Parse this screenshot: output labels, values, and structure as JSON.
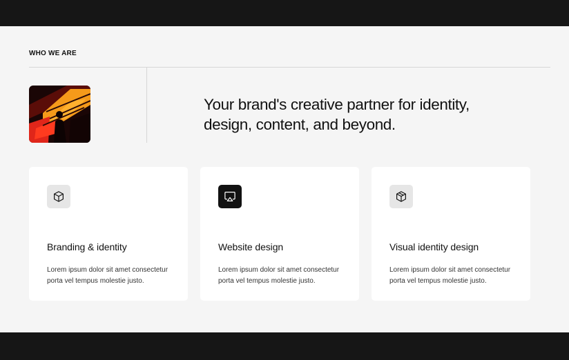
{
  "section": {
    "eyebrow": "WHO WE ARE",
    "headline": "Your brand's creative partner for identity, design, content, and beyond.",
    "image": {
      "subject": "figure-in-orange-stairwell-photo"
    }
  },
  "services": [
    {
      "icon": "cube-icon",
      "title": "Branding & identity",
      "description": "Lorem ipsum dolor sit amet consectetur porta vel tempus molestie justo."
    },
    {
      "icon": "airplay-icon",
      "title": "Website design",
      "description": "Lorem ipsum dolor sit amet consectetur porta vel tempus molestie justo."
    },
    {
      "icon": "package-icon",
      "title": "Visual identity design",
      "description": "Lorem ipsum dolor sit amet consectetur porta vel tempus molestie justo."
    }
  ],
  "colors": {
    "page_background": "#f5f5f5",
    "bar_background": "#161616",
    "card_background": "#ffffff",
    "icon_tile_light": "#e6e6e6",
    "icon_tile_dark": "#121212",
    "accent_orange": "#f59a1a",
    "accent_red": "#e0261a"
  }
}
